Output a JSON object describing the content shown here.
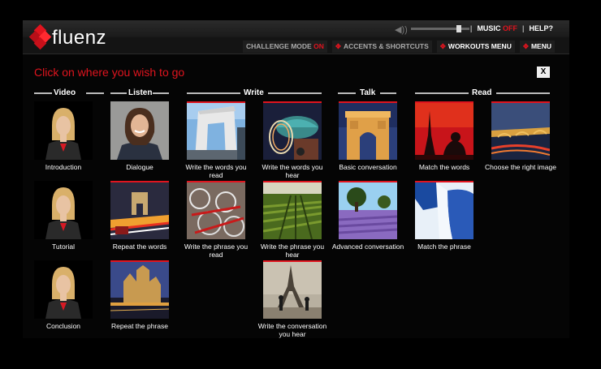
{
  "app": {
    "logo_text": "fluenz",
    "top": {
      "music_label": "MUSIC",
      "music_state": "OFF",
      "help_label": "HELP?",
      "sep": "|"
    },
    "menu": {
      "challenge_label": "CHALLENGE MODE",
      "challenge_state": "ON",
      "accents_label": "ACCENTS & SHORTCUTS",
      "workouts_label": "WORKOUTS MENU",
      "menu_label": "MENU"
    },
    "volume_level": 0.85
  },
  "page": {
    "heading": "Click on where you wish to go",
    "close_label": "X"
  },
  "sections": {
    "video": "Video",
    "listen": "Listen",
    "write": "Write",
    "talk": "Talk",
    "read": "Read"
  },
  "tiles": {
    "introduction": "Introduction",
    "dialogue": "Dialogue",
    "write_words_read": "Write the words you read",
    "write_words_hear": "Write the words you hear",
    "basic_conversation": "Basic conversation",
    "match_words": "Match the words",
    "choose_image": "Choose the right image",
    "tutorial": "Tutorial",
    "repeat_words": "Repeat the words",
    "write_phrase_read": "Write the phrase you read",
    "write_phrase_hear": "Write the phrase you hear",
    "advanced_conversation": "Advanced conversation",
    "match_phrase": "Match the phrase",
    "conclusion": "Conclusion",
    "repeat_phrase": "Repeat the phrase",
    "write_conversation_hear": "Write the conversation you hear"
  },
  "colors": {
    "accent": "#e0141e",
    "background": "#000000",
    "bar": "#1a1a1a"
  }
}
